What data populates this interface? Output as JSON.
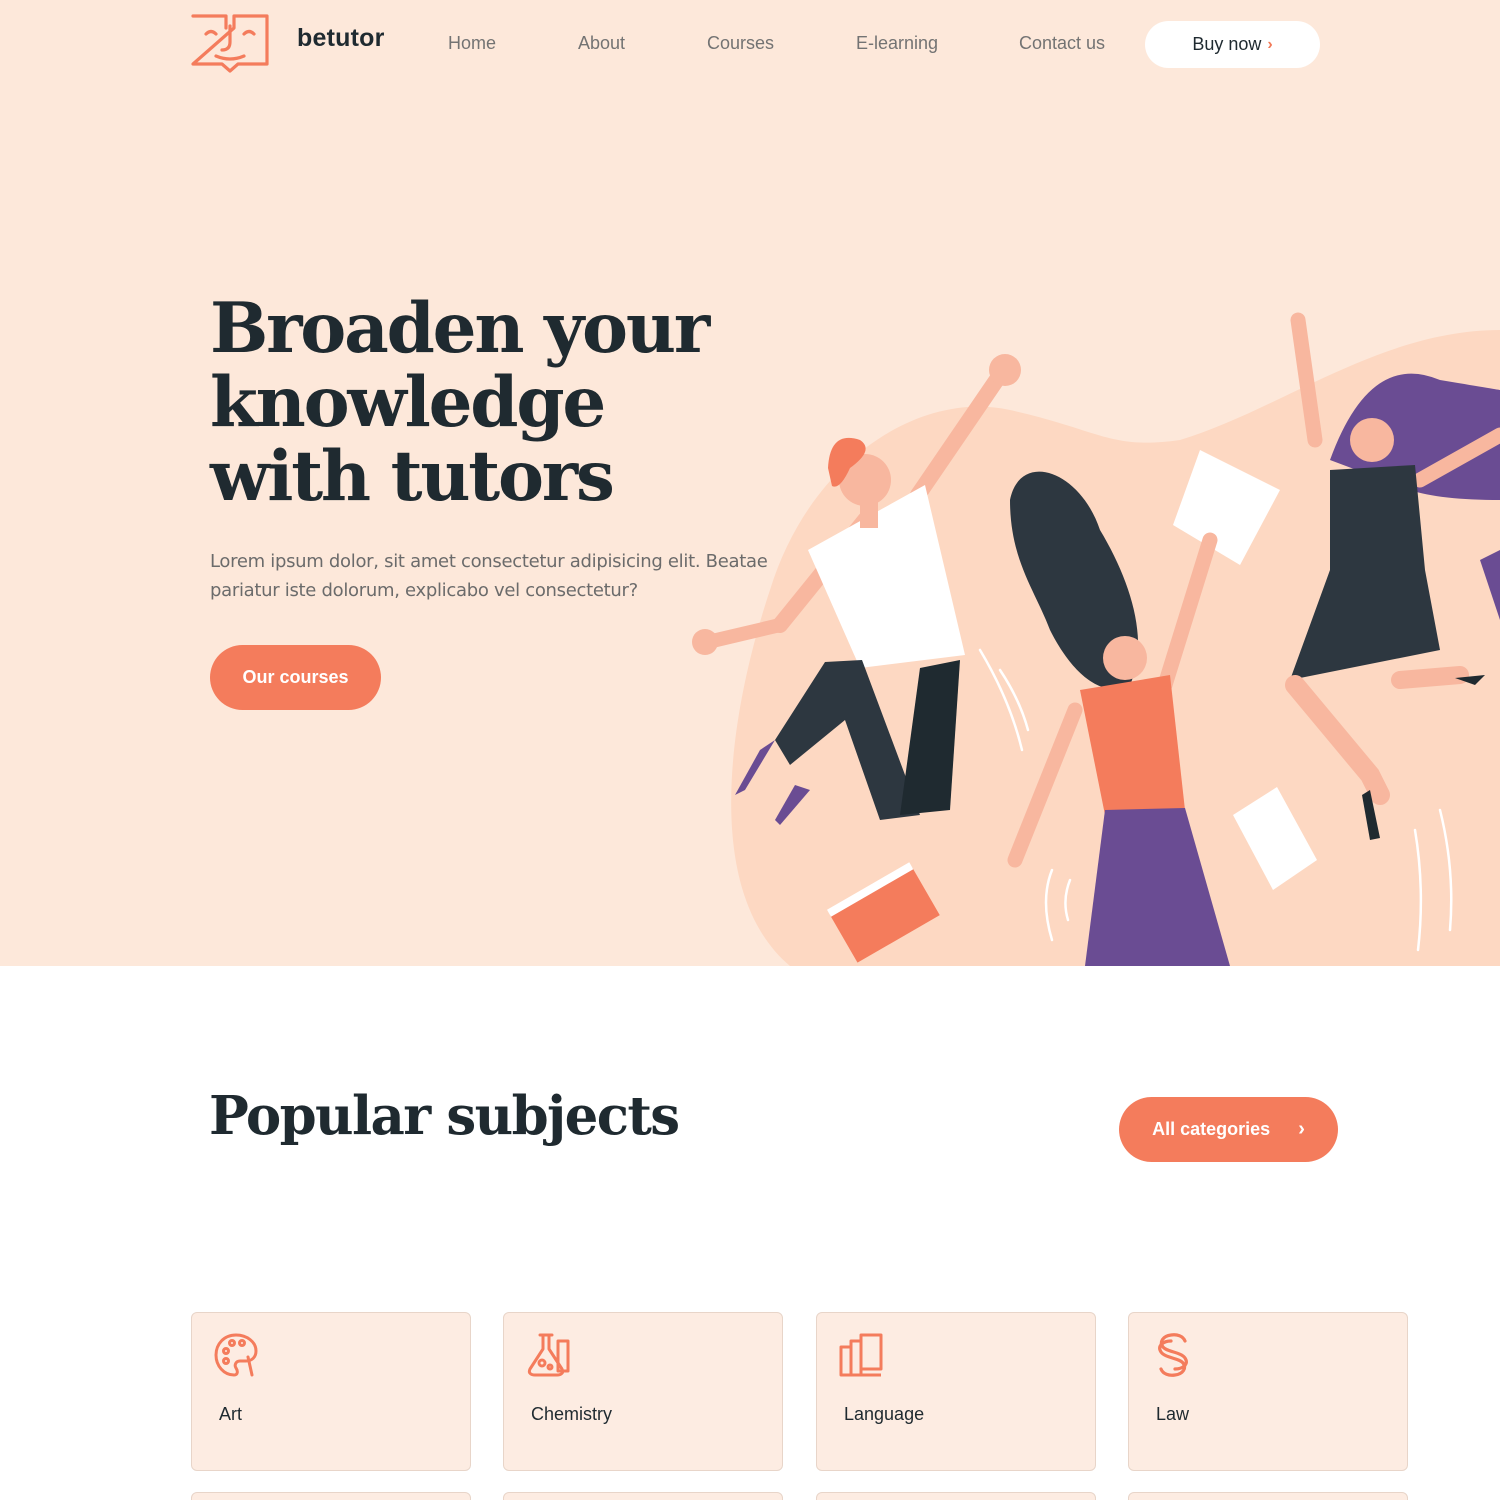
{
  "header": {
    "brand": "betutor",
    "logo_icon": "book-face-logo",
    "nav": [
      "Home",
      "About",
      "Courses",
      "E-learning",
      "Contact us"
    ],
    "buy_label": "Buy now"
  },
  "hero": {
    "title_lines": [
      "Broaden your",
      "knowledge",
      "with tutors"
    ],
    "text": "Lorem ipsum dolor, sit amet consectetur adipisicing elit. Beatae pariatur iste dolorum, explicabo vel consectetur?",
    "cta": "Our courses"
  },
  "subjects": {
    "title": "Popular subjects",
    "all_label": "All categories",
    "cards": [
      {
        "label": "Art",
        "icon": "palette-icon"
      },
      {
        "label": "Chemistry",
        "icon": "flask-icon"
      },
      {
        "label": "Language",
        "icon": "books-icon"
      },
      {
        "label": "Law",
        "icon": "section-sign-icon"
      }
    ]
  },
  "colors": {
    "accent": "#f47c5c",
    "hero_bg": "#fde8da",
    "card_bg": "#fdece2",
    "heading": "#1f2a30",
    "purple": "#6a4c93"
  }
}
